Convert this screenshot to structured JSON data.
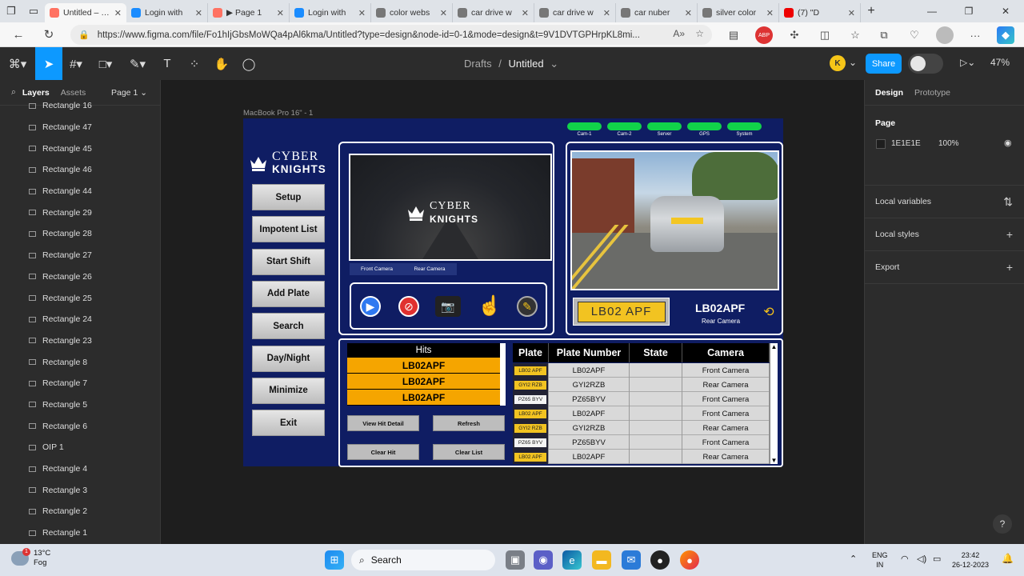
{
  "browser": {
    "tabs": [
      {
        "label": "Untitled – Figma",
        "color": "#ff7262",
        "active": true
      },
      {
        "label": "Login with",
        "color": "#1a8cff"
      },
      {
        "label": "▶ Page 1",
        "color": "#ff7262"
      },
      {
        "label": "Login with",
        "color": "#1a8cff"
      },
      {
        "label": "color webs",
        "color": "#777"
      },
      {
        "label": "car drive w",
        "color": "#777"
      },
      {
        "label": "car drive w",
        "color": "#777"
      },
      {
        "label": "car nuber",
        "color": "#777"
      },
      {
        "label": "silver color",
        "color": "#777"
      },
      {
        "label": "(7) \"D",
        "color": "#e00"
      }
    ],
    "url": "https://www.figma.com/file/Fo1hIjGbsMoWQa4pAl6kma/Untitled?type=design&node-id=0-1&mode=design&t=9V1DVTGPHrpKL8mi...",
    "ext_badge": "ABP"
  },
  "figma": {
    "breadcrumb_parent": "Drafts",
    "breadcrumb_sep": "/",
    "file_name": "Untitled",
    "avatar": "K",
    "share": "Share",
    "zoom": "47%",
    "left_tabs": {
      "layers": "Layers",
      "assets": "Assets",
      "page": "Page 1"
    },
    "layers": [
      "Rectangle 16",
      "Rectangle 47",
      "Rectangle 45",
      "Rectangle 46",
      "Rectangle 44",
      "Rectangle 29",
      "Rectangle 28",
      "Rectangle 27",
      "Rectangle 26",
      "Rectangle 25",
      "Rectangle 24",
      "Rectangle 23",
      "Rectangle 8",
      "Rectangle 7",
      "Rectangle 5",
      "Rectangle 6",
      "OIP 1",
      "Rectangle 4",
      "Rectangle 3",
      "Rectangle 2",
      "Rectangle 1"
    ],
    "right_tabs": {
      "design": "Design",
      "prototype": "Prototype"
    },
    "page_label": "Page",
    "page_color": "1E1E1E",
    "page_opacity": "100%",
    "sections": [
      "Local variables",
      "Local styles",
      "Export"
    ],
    "help": "?"
  },
  "frame": {
    "label": "MacBook Pro 16\" - 1",
    "logo_line1": "CYBER",
    "logo_line2": "KNIGHTS",
    "menu": [
      "Setup",
      "Impotent List",
      "Start Shift",
      "Add Plate",
      "Search",
      "Day/Night",
      "Minimize",
      "Exit"
    ],
    "status": [
      "Cam-1",
      "Cam-2",
      "Server",
      "GPS",
      "System"
    ],
    "camera_tabs": [
      "Front Camera",
      "Rear Camera"
    ],
    "detected_plate_image_text": "LB02 APF",
    "detected_plate": "LB02APF",
    "detected_camera": "Rear Camera",
    "hits": {
      "title": "Hits",
      "rows": [
        "LB02APF",
        "LB02APF",
        "LB02APF"
      ]
    },
    "buttons": {
      "view_hit": "View Hit Detail",
      "refresh": "Refresh",
      "clear_hit": "Clear Hit",
      "clear_list": "Clear List"
    },
    "table": {
      "headers": [
        "Plate",
        "Plate Number",
        "State",
        "Camera"
      ],
      "rows": [
        {
          "plate_img": "LB02 APF",
          "number": "LB02APF",
          "state": "",
          "camera": "Front Camera"
        },
        {
          "plate_img": "GYI2 RZB",
          "number": "GYI2RZB",
          "state": "",
          "camera": "Rear Camera"
        },
        {
          "plate_img": "PZ65 BYV",
          "number": "PZ65BYV",
          "state": "",
          "camera": "Front Camera"
        },
        {
          "plate_img": "LB02 APF",
          "number": "LB02APF",
          "state": "",
          "camera": "Front Camera"
        },
        {
          "plate_img": "GYI2 RZB",
          "number": "GYI2RZB",
          "state": "",
          "camera": "Rear Camera"
        },
        {
          "plate_img": "PZ65 BYV",
          "number": "PZ65BYV",
          "state": "",
          "camera": "Front Camera"
        },
        {
          "plate_img": "LB02 APF",
          "number": "LB02APF",
          "state": "",
          "camera": "Rear Camera"
        }
      ]
    },
    "colors": {
      "frame_bg": "#0f1d63",
      "status_ok": "#11d34a",
      "hit": "#f5a500"
    }
  },
  "taskbar": {
    "temp": "13°C",
    "condition": "Fog",
    "weather_badge": "1",
    "search": "Search",
    "lang1": "ENG",
    "lang2": "IN",
    "time": "23:42",
    "date": "26-12-2023"
  }
}
